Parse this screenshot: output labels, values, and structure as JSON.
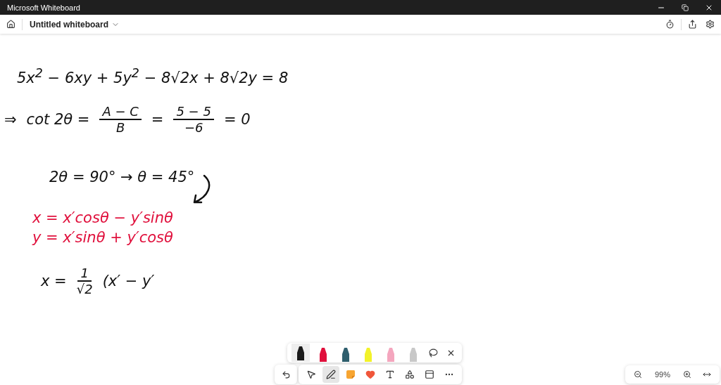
{
  "window": {
    "title": "Microsoft Whiteboard"
  },
  "header": {
    "title": "Untitled whiteboard"
  },
  "ink": [
    {
      "color": "#111111",
      "parts": [
        {
          "kind": "text",
          "text": "5x$^{2}$ − 6xy + 5y$^{2}$ − 8√2x + 8√2y = 8"
        }
      ]
    },
    {
      "color": "#111111",
      "parts": [
        {
          "kind": "text",
          "text": "⇒"
        },
        {
          "kind": "text",
          "text": "cot 2θ ="
        },
        {
          "kind": "fraction",
          "numerator": "A − C",
          "denominator": "B"
        },
        {
          "kind": "text",
          "text": "="
        },
        {
          "kind": "fraction",
          "numerator": "5 − 5",
          "denominator": "−6"
        },
        {
          "kind": "text",
          "text": "= 0"
        }
      ]
    },
    {
      "color": "#111111",
      "parts": [
        {
          "kind": "text",
          "text": "2θ = 90° → θ = 45°"
        }
      ]
    },
    {
      "color": "#e0103c",
      "parts": [
        {
          "kind": "text",
          "text": "x = x′cosθ − y′sinθ"
        }
      ]
    },
    {
      "color": "#e0103c",
      "parts": [
        {
          "kind": "text",
          "text": "y = x′sinθ + y′cosθ"
        }
      ]
    },
    {
      "color": "#111111",
      "parts": [
        {
          "kind": "text",
          "text": "x ="
        },
        {
          "kind": "fraction",
          "numerator": "1",
          "denominator": "√2"
        },
        {
          "kind": "text",
          "text": "(x′ − y′"
        }
      ]
    }
  ],
  "pens": [
    {
      "color": "#1a1a1a",
      "selected": true
    },
    {
      "color": "#e0103c",
      "selected": false
    },
    {
      "color": "#2f5f6e",
      "selected": false
    },
    {
      "color": "#f2f22a",
      "selected": false
    },
    {
      "color": "#f4a6be",
      "selected": false
    },
    {
      "color": "#c8c8c8",
      "selected": false
    }
  ],
  "tools": [
    {
      "kind": "select",
      "selected": false
    },
    {
      "kind": "pen",
      "selected": true
    },
    {
      "kind": "note",
      "selected": false
    },
    {
      "kind": "heart",
      "selected": false
    },
    {
      "kind": "text",
      "selected": false
    },
    {
      "kind": "shapes",
      "selected": false
    },
    {
      "kind": "template",
      "selected": false
    },
    {
      "kind": "more",
      "selected": false
    }
  ],
  "zoom": {
    "reading": "99%"
  }
}
